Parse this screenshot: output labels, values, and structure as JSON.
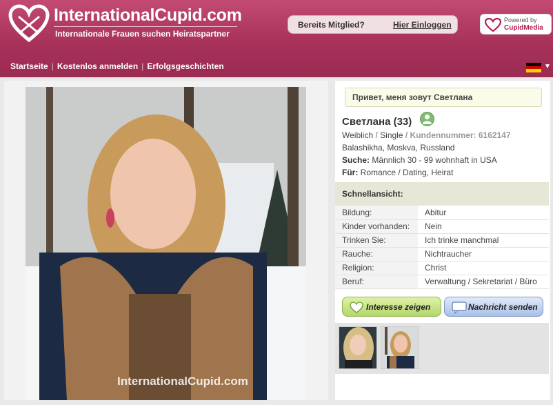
{
  "header": {
    "logo_text": "InternationalCupid.com",
    "tagline": "Internationale Frauen suchen Heiratspartner",
    "member_question": "Bereits Mitglied?",
    "login_link": "Hier Einloggen",
    "powered_by_label": "Powered by",
    "powered_by_brand": "CupidMedia",
    "brand_color": "#a8325b"
  },
  "nav": {
    "items": [
      "Startseite",
      "Kostenlos anmelden",
      "Erfolgsgeschichten"
    ],
    "language_flag": "flag-de-icon"
  },
  "profile": {
    "greeting": "Привет, меня зовут Светлана",
    "name": "Светлана (33)",
    "gender": "Weiblich",
    "status": "Single",
    "customer_label": "Kundennummer:",
    "customer_number": "6162147",
    "location": "Balashikha, Moskva, Russland",
    "search_label": "Suche:",
    "search_value": "Männlich 30 - 99 wohnhaft in USA",
    "for_label": "Für:",
    "for_value": "Romance / Dating, Heirat",
    "online_icon": "user-online-icon"
  },
  "quick_view": {
    "title": "Schnellansicht:",
    "rows": [
      {
        "label": "Bildung:",
        "value": "Abitur"
      },
      {
        "label": "Kinder vorhanden:",
        "value": "Nein"
      },
      {
        "label": "Trinken Sie:",
        "value": "Ich trinke manchmal"
      },
      {
        "label": "Rauche:",
        "value": "Nichtraucher"
      },
      {
        "label": "Religion:",
        "value": "Christ"
      },
      {
        "label": "Beruf:",
        "value": "Verwaltung / Sekretariat / Büro"
      }
    ]
  },
  "actions": {
    "interest": "Interesse zeigen",
    "message": "Nachricht senden"
  },
  "photo": {
    "watermark": "InternationalCupid.com"
  }
}
